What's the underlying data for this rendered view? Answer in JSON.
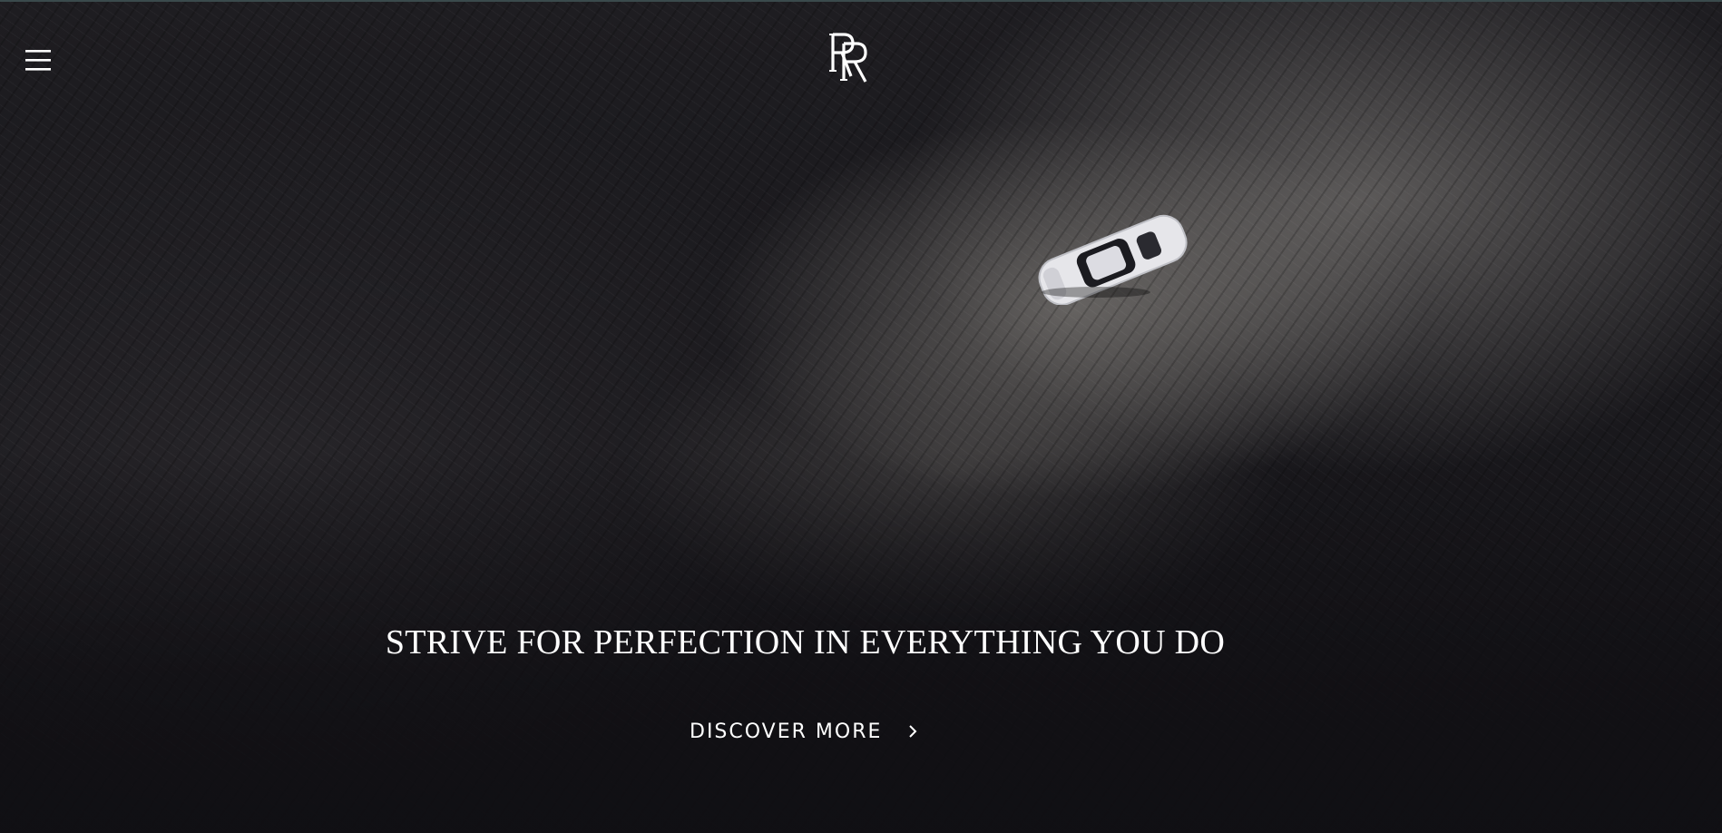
{
  "header": {
    "menu_icon": "hamburger-menu-icon",
    "logo_icon": "rr-monogram-logo-icon"
  },
  "hero": {
    "headline": "STRIVE FOR PERFECTION IN EVERYTHING YOU DO",
    "cta_label": "DISCOVER MORE",
    "cta_icon": "chevron-right-icon"
  },
  "colors": {
    "text": "#ffffff",
    "background": "#17161a",
    "top_accent": "#3a4a4c"
  }
}
